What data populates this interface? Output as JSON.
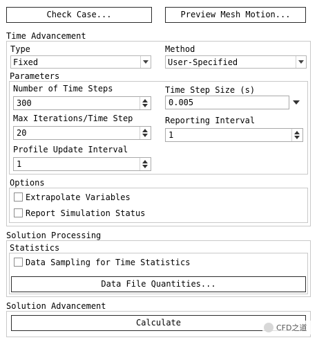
{
  "top_buttons": {
    "check_case": "Check Case...",
    "preview_mesh": "Preview Mesh Motion..."
  },
  "time_advancement": {
    "title": "Time Advancement",
    "type_label": "Type",
    "type_value": "Fixed",
    "method_label": "Method",
    "method_value": "User-Specified"
  },
  "parameters": {
    "title": "Parameters",
    "num_steps_label": "Number of Time Steps",
    "num_steps_value": "300",
    "step_size_label": "Time Step Size (s)",
    "step_size_value": "0.005",
    "max_iter_label": "Max Iterations/Time Step",
    "max_iter_value": "20",
    "reporting_label": "Reporting Interval",
    "reporting_value": "1",
    "profile_label": "Profile Update Interval",
    "profile_value": "1"
  },
  "options": {
    "title": "Options",
    "extrapolate": "Extrapolate Variables",
    "report_status": "Report Simulation Status"
  },
  "solution_processing": {
    "title": "Solution Processing",
    "statistics_title": "Statistics",
    "data_sampling": "Data Sampling for Time Statistics",
    "data_file_button": "Data File Quantities..."
  },
  "solution_advancement": {
    "title": "Solution Advancement",
    "calculate_button": "Calculate"
  },
  "watermark": {
    "text": "CFD之道"
  }
}
